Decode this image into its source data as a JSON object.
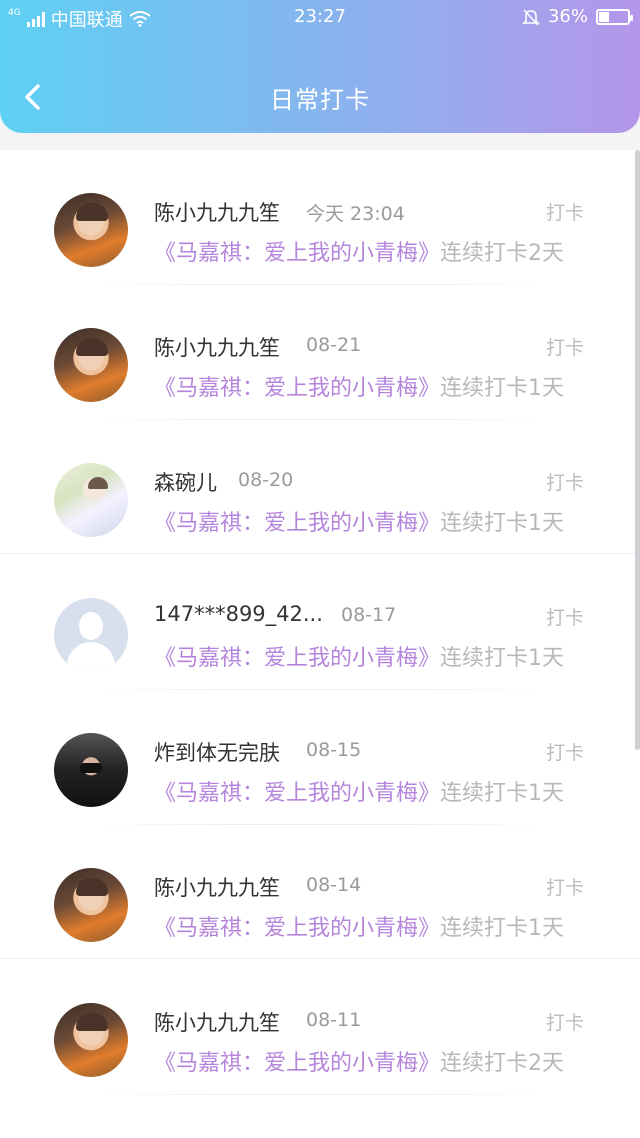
{
  "status_bar": {
    "carrier": "中国联通",
    "network": "4G",
    "time": "23:27",
    "battery": "36%",
    "battery_level": 0.36
  },
  "header": {
    "title": "日常打卡",
    "gradient": [
      "#5ed0f3",
      "#b596ea"
    ]
  },
  "entries": [
    {
      "name": "陈小九九九笙",
      "time": "今天 23:04",
      "action": "打卡",
      "book": "《马嘉祺：爱上我的小青梅》",
      "streak": "连续打卡2天"
    },
    {
      "name": "陈小九九九笙",
      "time": "08-21",
      "action": "打卡",
      "book": "《马嘉祺：爱上我的小青梅》",
      "streak": "连续打卡1天"
    },
    {
      "name": "森碗儿",
      "time": "08-20",
      "action": "打卡",
      "book": "《马嘉祺：爱上我的小青梅》",
      "streak": "连续打卡1天"
    },
    {
      "name": "147***899_42...",
      "time": "08-17",
      "action": "打卡",
      "book": "《马嘉祺：爱上我的小青梅》",
      "streak": "连续打卡1天"
    },
    {
      "name": "炸到体无完肤",
      "time": "08-15",
      "action": "打卡",
      "book": "《马嘉祺：爱上我的小青梅》",
      "streak": "连续打卡1天"
    },
    {
      "name": "陈小九九九笙",
      "time": "08-14",
      "action": "打卡",
      "book": "《马嘉祺：爱上我的小青梅》",
      "streak": "连续打卡1天"
    },
    {
      "name": "陈小九九九笙",
      "time": "08-11",
      "action": "打卡",
      "book": "《马嘉祺：爱上我的小青梅》",
      "streak": "连续打卡2天"
    }
  ],
  "colors": {
    "book_title": "#b585dc",
    "streak_text": "#b8b8b8",
    "action_text": "#bcbcbc"
  },
  "icons": {
    "back": "chevron-left-icon",
    "wifi": "wifi-icon",
    "bell": "bell-off-icon",
    "battery": "battery-icon",
    "signal": "signal-icon"
  }
}
